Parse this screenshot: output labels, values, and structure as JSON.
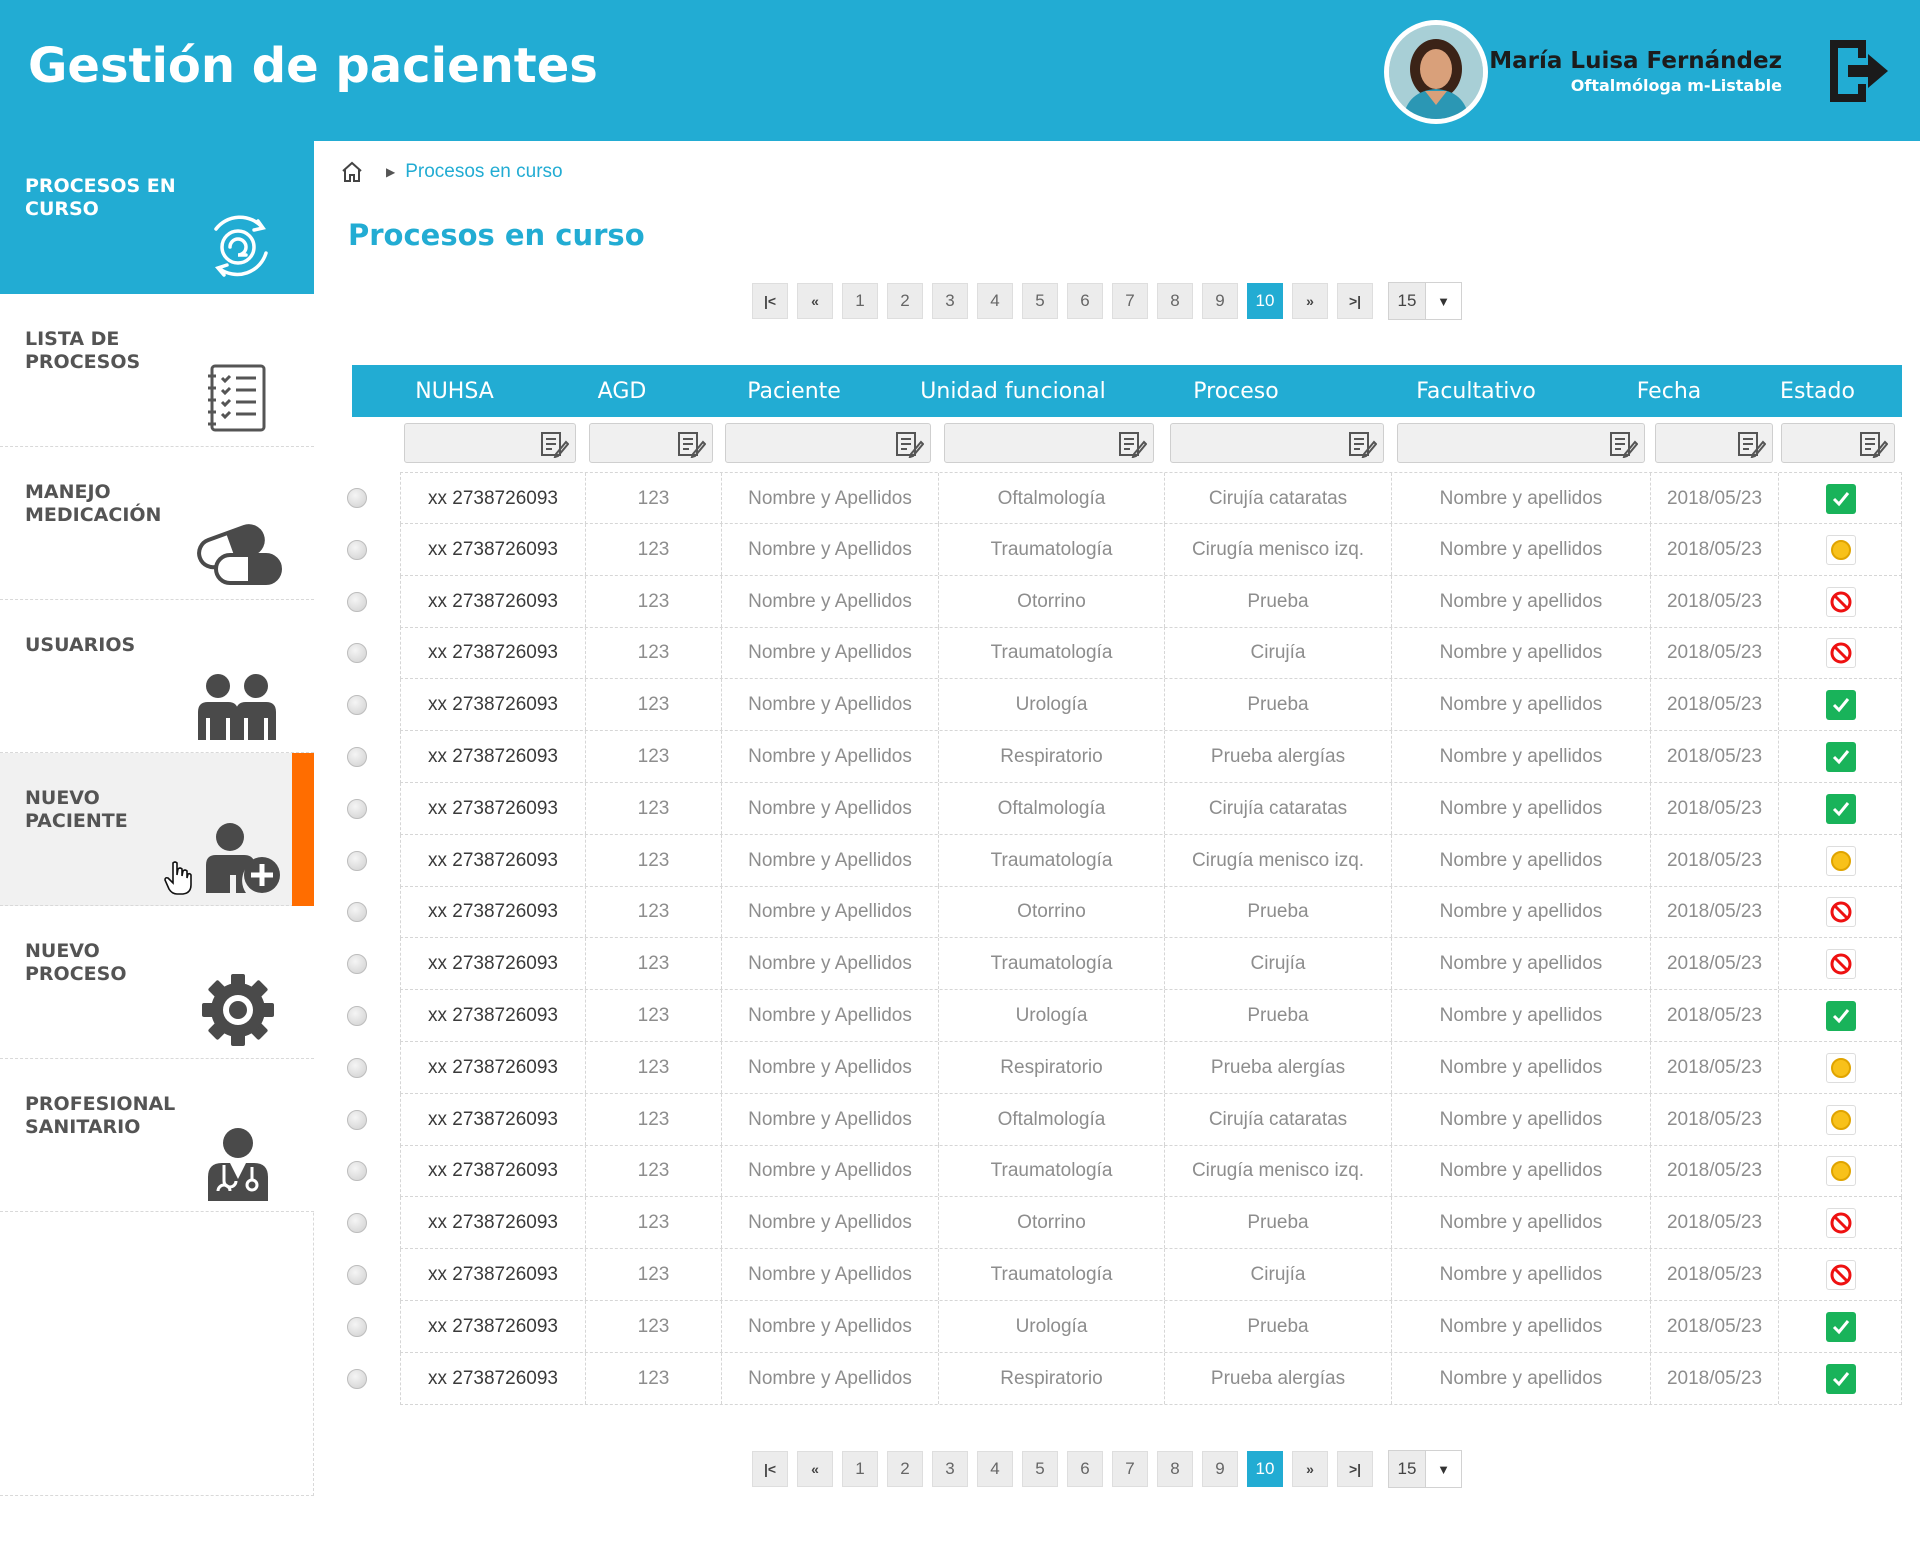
{
  "header": {
    "title": "Gestión de pacientes",
    "user_name": "María Luisa Fernández",
    "user_role": "Oftalmóloga m-Listable",
    "brand_color": "#22acd3",
    "accent_color": "#ff6d00"
  },
  "sidebar": {
    "items": [
      {
        "label": "PROCESOS EN CURSO",
        "icon": "process-cycle-icon",
        "state": "active"
      },
      {
        "label": "LISTA DE PROCESOS",
        "icon": "checklist-icon",
        "state": "normal"
      },
      {
        "label": "MANEJO MEDICACIÓN",
        "icon": "pills-icon",
        "state": "normal"
      },
      {
        "label": "USUARIOS",
        "icon": "users-icon",
        "state": "normal"
      },
      {
        "label": "NUEVO PACIENTE",
        "icon": "add-user-icon",
        "state": "hover"
      },
      {
        "label": "NUEVO PROCESO",
        "icon": "gear-icon",
        "state": "normal"
      },
      {
        "label": "PROFESIONAL SANITARIO",
        "icon": "doctor-icon",
        "state": "normal"
      }
    ]
  },
  "breadcrumb": {
    "current": "Procesos en curso"
  },
  "page_title": "Procesos en curso",
  "pagination": {
    "pages": [
      "1",
      "2",
      "3",
      "4",
      "5",
      "6",
      "7",
      "8",
      "9",
      "10"
    ],
    "current": "10",
    "page_size": "15"
  },
  "table": {
    "columns": [
      "NUHSA",
      "AGD",
      "Paciente",
      "Unidad funcional",
      "Proceso",
      "Facultativo",
      "Fecha",
      "Estado"
    ],
    "rows": [
      {
        "nuhsa": "xx 2738726093",
        "agd": "123",
        "paciente": "Nombre y Apellidos",
        "unidad": "Oftalmología",
        "proceso": "Cirujía cataratas",
        "facultativo": "Nombre y apellidos",
        "fecha": "2018/05/23",
        "estado": "ok"
      },
      {
        "nuhsa": "xx 2738726093",
        "agd": "123",
        "paciente": "Nombre y Apellidos",
        "unidad": "Traumatología",
        "proceso": "Cirugía menisco izq.",
        "facultativo": "Nombre y apellidos",
        "fecha": "2018/05/23",
        "estado": "warn"
      },
      {
        "nuhsa": "xx 2738726093",
        "agd": "123",
        "paciente": "Nombre y Apellidos",
        "unidad": "Otorrino",
        "proceso": "Prueba",
        "facultativo": "Nombre y apellidos",
        "fecha": "2018/05/23",
        "estado": "ban"
      },
      {
        "nuhsa": "xx 2738726093",
        "agd": "123",
        "paciente": "Nombre y Apellidos",
        "unidad": "Traumatología",
        "proceso": "Cirujía",
        "facultativo": "Nombre y apellidos",
        "fecha": "2018/05/23",
        "estado": "ban"
      },
      {
        "nuhsa": "xx 2738726093",
        "agd": "123",
        "paciente": "Nombre y Apellidos",
        "unidad": "Urología",
        "proceso": "Prueba",
        "facultativo": "Nombre y apellidos",
        "fecha": "2018/05/23",
        "estado": "ok"
      },
      {
        "nuhsa": "xx 2738726093",
        "agd": "123",
        "paciente": "Nombre y Apellidos",
        "unidad": "Respiratorio",
        "proceso": "Prueba alergías",
        "facultativo": "Nombre y apellidos",
        "fecha": "2018/05/23",
        "estado": "ok"
      },
      {
        "nuhsa": "xx 2738726093",
        "agd": "123",
        "paciente": "Nombre y Apellidos",
        "unidad": "Oftalmología",
        "proceso": "Cirujía cataratas",
        "facultativo": "Nombre y apellidos",
        "fecha": "2018/05/23",
        "estado": "ok"
      },
      {
        "nuhsa": "xx 2738726093",
        "agd": "123",
        "paciente": "Nombre y Apellidos",
        "unidad": "Traumatología",
        "proceso": "Cirugía menisco izq.",
        "facultativo": "Nombre y apellidos",
        "fecha": "2018/05/23",
        "estado": "warn"
      },
      {
        "nuhsa": "xx 2738726093",
        "agd": "123",
        "paciente": "Nombre y Apellidos",
        "unidad": "Otorrino",
        "proceso": "Prueba",
        "facultativo": "Nombre y apellidos",
        "fecha": "2018/05/23",
        "estado": "ban"
      },
      {
        "nuhsa": "xx 2738726093",
        "agd": "123",
        "paciente": "Nombre y Apellidos",
        "unidad": "Traumatología",
        "proceso": "Cirujía",
        "facultativo": "Nombre y apellidos",
        "fecha": "2018/05/23",
        "estado": "ban"
      },
      {
        "nuhsa": "xx 2738726093",
        "agd": "123",
        "paciente": "Nombre y Apellidos",
        "unidad": "Urología",
        "proceso": "Prueba",
        "facultativo": "Nombre y apellidos",
        "fecha": "2018/05/23",
        "estado": "ok"
      },
      {
        "nuhsa": "xx 2738726093",
        "agd": "123",
        "paciente": "Nombre y Apellidos",
        "unidad": "Respiratorio",
        "proceso": "Prueba alergías",
        "facultativo": "Nombre y apellidos",
        "fecha": "2018/05/23",
        "estado": "warn"
      },
      {
        "nuhsa": "xx 2738726093",
        "agd": "123",
        "paciente": "Nombre y Apellidos",
        "unidad": "Oftalmología",
        "proceso": "Cirujía cataratas",
        "facultativo": "Nombre y apellidos",
        "fecha": "2018/05/23",
        "estado": "warn"
      },
      {
        "nuhsa": "xx 2738726093",
        "agd": "123",
        "paciente": "Nombre y Apellidos",
        "unidad": "Traumatología",
        "proceso": "Cirugía menisco izq.",
        "facultativo": "Nombre y apellidos",
        "fecha": "2018/05/23",
        "estado": "warn"
      },
      {
        "nuhsa": "xx 2738726093",
        "agd": "123",
        "paciente": "Nombre y Apellidos",
        "unidad": "Otorrino",
        "proceso": "Prueba",
        "facultativo": "Nombre y apellidos",
        "fecha": "2018/05/23",
        "estado": "ban"
      },
      {
        "nuhsa": "xx 2738726093",
        "agd": "123",
        "paciente": "Nombre y Apellidos",
        "unidad": "Traumatología",
        "proceso": "Cirujía",
        "facultativo": "Nombre y apellidos",
        "fecha": "2018/05/23",
        "estado": "ban"
      },
      {
        "nuhsa": "xx 2738726093",
        "agd": "123",
        "paciente": "Nombre y Apellidos",
        "unidad": "Urología",
        "proceso": "Prueba",
        "facultativo": "Nombre y apellidos",
        "fecha": "2018/05/23",
        "estado": "ok"
      },
      {
        "nuhsa": "xx 2738726093",
        "agd": "123",
        "paciente": "Nombre y Apellidos",
        "unidad": "Respiratorio",
        "proceso": "Prueba alergías",
        "facultativo": "Nombre y apellidos",
        "fecha": "2018/05/23",
        "estado": "ok"
      }
    ]
  }
}
